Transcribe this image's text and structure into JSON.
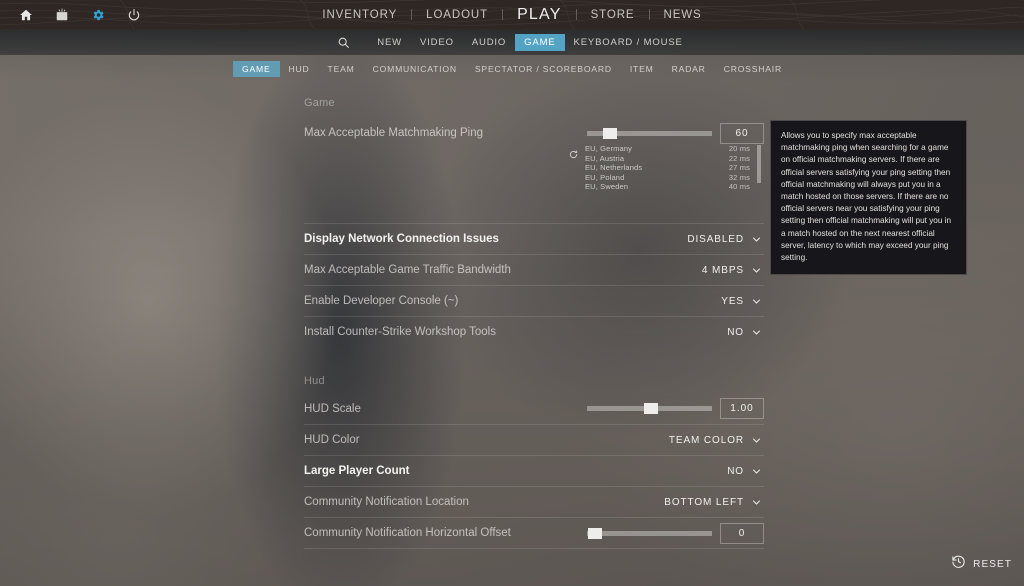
{
  "window": {
    "app_title": "Counter-Strike Settings"
  },
  "topbar": {
    "system_icons": [
      {
        "name": "home-icon",
        "label": "Home"
      },
      {
        "name": "tv-icon",
        "label": "Watch"
      },
      {
        "name": "gear-icon",
        "label": "Settings"
      },
      {
        "name": "power-icon",
        "label": "Quit"
      }
    ],
    "accent_color": "#2ea4d8",
    "nav": [
      {
        "label": "INVENTORY",
        "active": false
      },
      {
        "label": "LOADOUT",
        "active": false
      },
      {
        "label": "PLAY",
        "active": true
      },
      {
        "label": "STORE",
        "active": false
      },
      {
        "label": "NEWS",
        "active": false
      }
    ]
  },
  "subnav": {
    "search_icon": "search-icon",
    "categories": [
      {
        "label": "NEW",
        "active": false
      },
      {
        "label": "VIDEO",
        "active": false
      },
      {
        "label": "AUDIO",
        "active": false
      },
      {
        "label": "GAME",
        "active": true
      },
      {
        "label": "KEYBOARD / MOUSE",
        "active": false
      }
    ],
    "active_color": "#53a3c4"
  },
  "tabs": [
    {
      "label": "GAME",
      "active": true
    },
    {
      "label": "HUD",
      "active": false
    },
    {
      "label": "TEAM",
      "active": false
    },
    {
      "label": "COMMUNICATION",
      "active": false
    },
    {
      "label": "SPECTATOR / SCOREBOARD",
      "active": false
    },
    {
      "label": "ITEM",
      "active": false
    },
    {
      "label": "RADAR",
      "active": false
    },
    {
      "label": "CROSSHAIR",
      "active": false
    }
  ],
  "sections": {
    "game": {
      "header": "Game",
      "rows": [
        {
          "label": "Max Acceptable Matchmaking Ping",
          "type": "slider",
          "value": "60",
          "fill_percent": 22,
          "highlighted": false
        },
        {
          "label": "Display Network Connection Issues",
          "type": "dropdown",
          "value": "DISABLED",
          "highlighted": true
        },
        {
          "label": "Max Acceptable Game Traffic Bandwidth",
          "type": "dropdown",
          "value": "4 MBPS",
          "highlighted": false
        },
        {
          "label": "Enable Developer Console (~)",
          "type": "dropdown",
          "value": "YES",
          "highlighted": false
        },
        {
          "label": "Install Counter-Strike Workshop Tools",
          "type": "dropdown",
          "value": "NO",
          "highlighted": false
        }
      ]
    },
    "hud": {
      "header": "Hud",
      "rows": [
        {
          "label": "HUD Scale",
          "type": "slider",
          "value": "1.00",
          "fill_percent": 50,
          "highlighted": false
        },
        {
          "label": "HUD Color",
          "type": "dropdown",
          "value": "TEAM COLOR",
          "highlighted": false
        },
        {
          "label": "Large Player Count",
          "type": "dropdown",
          "value": "NO",
          "highlighted": true
        },
        {
          "label": "Community Notification Location",
          "type": "dropdown",
          "value": "BOTTOM LEFT",
          "highlighted": false
        },
        {
          "label": "Community Notification Horizontal Offset",
          "type": "slider",
          "value": "0",
          "fill_percent": 4,
          "highlighted": false
        }
      ]
    }
  },
  "ping_list": {
    "refresh_icon": "refresh-icon",
    "servers": [
      {
        "region": "EU, Germany",
        "ping": "20 ms"
      },
      {
        "region": "EU, Austria",
        "ping": "22 ms"
      },
      {
        "region": "EU, Netherlands",
        "ping": "27 ms"
      },
      {
        "region": "EU, Poland",
        "ping": "32 ms"
      },
      {
        "region": "EU, Sweden",
        "ping": "40 ms"
      }
    ]
  },
  "tooltip": {
    "text": "Allows you to specify max acceptable matchmaking ping when searching for a game on official matchmaking servers. If there are official servers satisfying your ping setting then official matchmaking will always put you in a match hosted on those servers. If there are no official servers near you satisfying your ping setting then official matchmaking will put you in a match hosted on the next nearest official server, latency to which may exceed your ping setting."
  },
  "reset": {
    "label": "RESET",
    "icon": "history-reset-icon"
  }
}
